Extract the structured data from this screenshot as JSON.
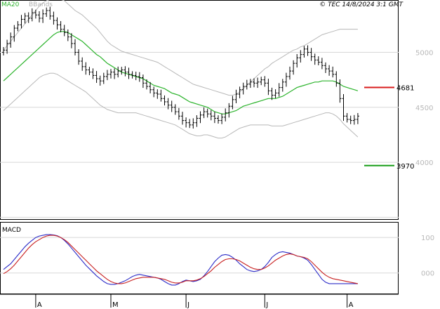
{
  "legend": {
    "ma": "MA20",
    "bbands": "BBands"
  },
  "copyright": "© TEC 14/8/2024 3:1 GMT",
  "chart_data": [
    {
      "type": "ohlc",
      "panel": "price",
      "ylim": [
        3560,
        5380
      ],
      "yticks": [
        {
          "value": 5000,
          "label": "5000"
        },
        {
          "value": 4500,
          "label": "4500"
        },
        {
          "value": 4000,
          "label": "4000"
        }
      ],
      "months": [
        {
          "index": 9,
          "label": "A"
        },
        {
          "index": 30,
          "label": "M"
        },
        {
          "index": 51,
          "label": "J"
        },
        {
          "index": 73,
          "label": "J"
        },
        {
          "index": 96,
          "label": "A"
        }
      ],
      "levels": [
        {
          "name": "resistance",
          "value": 4681,
          "label": "4681",
          "color": "#d91c1c"
        },
        {
          "name": "support",
          "value": 3970,
          "label": "3970",
          "color": "#1a9e1a"
        }
      ],
      "closes": [
        5020,
        5080,
        5140,
        5220,
        5250,
        5300,
        5330,
        5310,
        5360,
        5340,
        5310,
        5350,
        5380,
        5330,
        5290,
        5250,
        5210,
        5180,
        5140,
        5080,
        5000,
        4920,
        4870,
        4840,
        4820,
        4790,
        4760,
        4740,
        4780,
        4800,
        4820,
        4800,
        4830,
        4840,
        4820,
        4800,
        4790,
        4780,
        4770,
        4720,
        4690,
        4660,
        4630,
        4620,
        4580,
        4550,
        4520,
        4500,
        4460,
        4420,
        4380,
        4360,
        4340,
        4360,
        4400,
        4430,
        4460,
        4440,
        4420,
        4400,
        4380,
        4410,
        4450,
        4510,
        4570,
        4620,
        4660,
        4690,
        4710,
        4730,
        4720,
        4730,
        4750,
        4720,
        4650,
        4610,
        4630,
        4680,
        4730,
        4780,
        4830,
        4900,
        4950,
        4980,
        5030,
        5000,
        4960,
        4930,
        4910,
        4880,
        4850,
        4830,
        4800,
        4720,
        4580,
        4420,
        4390,
        4380,
        4390,
        4420
      ],
      "series": [
        {
          "name": "MA20",
          "color": "#2db42d",
          "values": [
            4740,
            4770,
            4800,
            4830,
            4860,
            4890,
            4920,
            4950,
            4980,
            5010,
            5040,
            5070,
            5100,
            5130,
            5160,
            5180,
            5190,
            5190,
            5180,
            5160,
            5140,
            5120,
            5100,
            5070,
            5040,
            5010,
            4980,
            4960,
            4930,
            4900,
            4880,
            4860,
            4840,
            4820,
            4810,
            4800,
            4790,
            4780,
            4770,
            4760,
            4740,
            4720,
            4700,
            4690,
            4680,
            4670,
            4650,
            4630,
            4620,
            4610,
            4590,
            4570,
            4550,
            4540,
            4530,
            4520,
            4510,
            4500,
            4480,
            4460,
            4450,
            4440,
            4440,
            4450,
            4460,
            4470,
            4490,
            4510,
            4520,
            4530,
            4540,
            4550,
            4560,
            4570,
            4580,
            4580,
            4580,
            4590,
            4600,
            4620,
            4640,
            4660,
            4680,
            4690,
            4700,
            4710,
            4720,
            4730,
            4730,
            4740,
            4740,
            4740,
            4740,
            4730,
            4710,
            4690,
            4680,
            4670,
            4660,
            4650
          ]
        },
        {
          "name": "BBands upper",
          "color": "#b8b8b8",
          "values": [
            5020,
            5060,
            5100,
            5140,
            5180,
            5220,
            5260,
            5300,
            5340,
            5380,
            5420,
            5450,
            5470,
            5480,
            5490,
            5490,
            5480,
            5470,
            5440,
            5410,
            5380,
            5360,
            5340,
            5310,
            5280,
            5250,
            5220,
            5180,
            5140,
            5100,
            5070,
            5050,
            5030,
            5010,
            5000,
            4990,
            4980,
            4970,
            4960,
            4950,
            4940,
            4930,
            4920,
            4910,
            4890,
            4870,
            4850,
            4830,
            4810,
            4790,
            4770,
            4750,
            4730,
            4710,
            4700,
            4690,
            4680,
            4670,
            4660,
            4650,
            4640,
            4630,
            4620,
            4610,
            4610,
            4620,
            4640,
            4670,
            4700,
            4730,
            4760,
            4790,
            4820,
            4850,
            4870,
            4900,
            4920,
            4940,
            4960,
            4980,
            5000,
            5020,
            5030,
            5050,
            5060,
            5080,
            5100,
            5120,
            5140,
            5160,
            5170,
            5180,
            5190,
            5200,
            5210,
            5210,
            5210,
            5210,
            5210,
            5210
          ]
        },
        {
          "name": "BBands lower",
          "color": "#b8b8b8",
          "values": [
            4470,
            4500,
            4530,
            4560,
            4590,
            4620,
            4650,
            4680,
            4710,
            4740,
            4770,
            4790,
            4800,
            4810,
            4810,
            4800,
            4780,
            4760,
            4740,
            4720,
            4700,
            4680,
            4660,
            4640,
            4610,
            4580,
            4550,
            4520,
            4500,
            4480,
            4470,
            4460,
            4450,
            4450,
            4450,
            4450,
            4450,
            4450,
            4440,
            4430,
            4420,
            4410,
            4400,
            4390,
            4380,
            4370,
            4360,
            4350,
            4340,
            4320,
            4300,
            4280,
            4260,
            4250,
            4240,
            4240,
            4250,
            4250,
            4240,
            4230,
            4220,
            4220,
            4230,
            4250,
            4270,
            4290,
            4310,
            4320,
            4330,
            4340,
            4340,
            4340,
            4340,
            4340,
            4340,
            4330,
            4330,
            4330,
            4330,
            4340,
            4350,
            4360,
            4370,
            4380,
            4390,
            4400,
            4410,
            4420,
            4430,
            4440,
            4450,
            4450,
            4440,
            4420,
            4390,
            4350,
            4320,
            4290,
            4260,
            4230
          ]
        }
      ]
    },
    {
      "type": "line",
      "panel": "macd",
      "title": "MACD",
      "ylim": [
        -50,
        130
      ],
      "yticks": [
        {
          "value": 100,
          "label": "100"
        },
        {
          "value": 0,
          "label": "000"
        }
      ],
      "series": [
        {
          "name": "MACD",
          "color": "#2c2cc8",
          "values": [
            10,
            18,
            26,
            38,
            50,
            62,
            74,
            84,
            92,
            100,
            104,
            106,
            108,
            108,
            107,
            105,
            100,
            92,
            82,
            70,
            58,
            46,
            34,
            22,
            12,
            2,
            -8,
            -16,
            -24,
            -30,
            -32,
            -32,
            -30,
            -26,
            -22,
            -16,
            -10,
            -6,
            -4,
            -6,
            -8,
            -10,
            -12,
            -14,
            -18,
            -24,
            -30,
            -34,
            -34,
            -30,
            -24,
            -20,
            -22,
            -24,
            -22,
            -18,
            -8,
            4,
            18,
            32,
            42,
            50,
            52,
            50,
            44,
            36,
            26,
            18,
            10,
            6,
            4,
            6,
            10,
            18,
            30,
            44,
            52,
            58,
            60,
            58,
            56,
            52,
            48,
            46,
            42,
            36,
            24,
            10,
            -4,
            -18,
            -26,
            -30,
            -30,
            -30,
            -30,
            -30,
            -30,
            -30,
            -30,
            -30
          ]
        },
        {
          "name": "Signal",
          "color": "#c82020",
          "values": [
            -2,
            4,
            12,
            22,
            34,
            46,
            58,
            70,
            80,
            88,
            94,
            100,
            104,
            106,
            106,
            104,
            100,
            94,
            86,
            76,
            66,
            56,
            46,
            36,
            26,
            16,
            6,
            -2,
            -10,
            -18,
            -24,
            -28,
            -30,
            -30,
            -28,
            -24,
            -20,
            -16,
            -14,
            -12,
            -12,
            -12,
            -12,
            -14,
            -16,
            -18,
            -22,
            -26,
            -28,
            -28,
            -26,
            -22,
            -22,
            -22,
            -20,
            -16,
            -10,
            -2,
            6,
            16,
            24,
            32,
            38,
            40,
            40,
            38,
            34,
            28,
            22,
            16,
            12,
            10,
            10,
            14,
            20,
            28,
            36,
            42,
            48,
            52,
            54,
            52,
            48,
            46,
            44,
            40,
            32,
            22,
            12,
            2,
            -6,
            -12,
            -16,
            -18,
            -20,
            -22,
            -24,
            -26,
            -28,
            -30
          ]
        }
      ]
    }
  ]
}
